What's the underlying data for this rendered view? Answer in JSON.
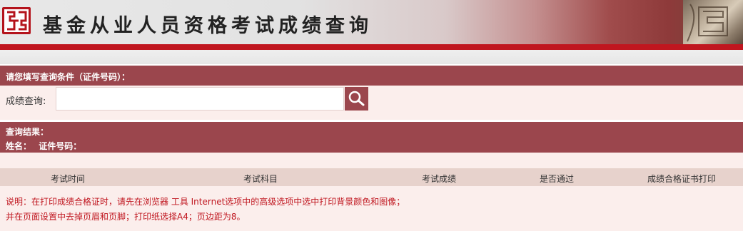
{
  "header": {
    "title": "基金从业人员资格考试成绩查询"
  },
  "query_section": {
    "heading": "请您填写查询条件（证件号码）：",
    "search_label": "成绩查询:",
    "search_value": "",
    "search_placeholder": ""
  },
  "result_section": {
    "heading": "查询结果：",
    "name_label": "姓名：",
    "id_label": "证件号码："
  },
  "table": {
    "columns": [
      "考试时间",
      "考试科目",
      "考试成绩",
      "是否通过",
      "成绩合格证书打印"
    ]
  },
  "notes": {
    "line1": "说明：在打印成绩合格证时，请先在浏览器 工具 Internet选项中的高级选项中选中打印背景颜色和图像；",
    "line2": "并在页面设置中去掉页眉和页脚；打印纸选择A4；页边距为8。"
  },
  "colors": {
    "accent": "#9b464d",
    "brand_red": "#c0161f",
    "panel_bg": "#fbeeec",
    "table_header_bg": "#e7d2cc"
  },
  "icons": {
    "logo": "seal-logo-icon",
    "search": "search-icon",
    "decoration": "carved-seal-image"
  }
}
